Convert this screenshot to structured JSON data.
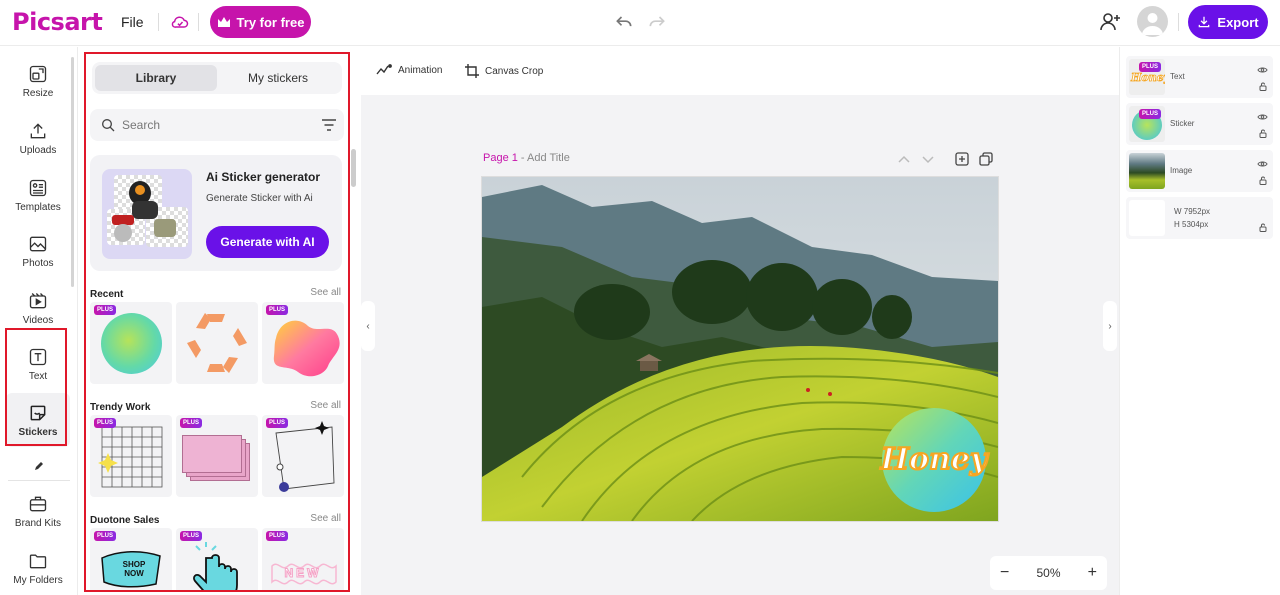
{
  "header": {
    "logo": "Picsart",
    "file_label": "File",
    "try_button": "Try for free",
    "export_button": "Export"
  },
  "nav": {
    "items": [
      {
        "label": "Resize",
        "icon": "resize-icon"
      },
      {
        "label": "Uploads",
        "icon": "upload-icon"
      },
      {
        "label": "Templates",
        "icon": "templates-icon"
      },
      {
        "label": "Photos",
        "icon": "photos-icon"
      },
      {
        "label": "Videos",
        "icon": "videos-icon"
      },
      {
        "label": "Text",
        "icon": "text-icon"
      },
      {
        "label": "Stickers",
        "icon": "stickers-icon"
      },
      {
        "label": "Brand Kits",
        "icon": "brand-kits-icon"
      },
      {
        "label": "My Folders",
        "icon": "folder-icon"
      }
    ],
    "active": "Stickers"
  },
  "panel": {
    "tabs": [
      "Library",
      "My stickers"
    ],
    "active_tab": "Library",
    "search_placeholder": "Search",
    "ai_card": {
      "title": "Ai Sticker generator",
      "subtitle": "Generate Sticker with Ai",
      "button": "Generate with AI"
    },
    "plus_badge": "PLUS",
    "sections": [
      {
        "title": "Recent",
        "see_all": "See all"
      },
      {
        "title": "Trendy Work",
        "see_all": "See all"
      },
      {
        "title": "Duotone Sales",
        "see_all": "See all"
      }
    ],
    "sticker_texts": {
      "shop_now": "SHOP NOW",
      "new": "NEW"
    }
  },
  "canvas": {
    "tools": [
      "Animation",
      "Canvas Crop"
    ],
    "page_label": "Page 1",
    "page_separator": " - ",
    "add_title": "Add Title",
    "sticker_text": "Honey",
    "zoom": "50%"
  },
  "layers": [
    {
      "name": "Text",
      "plus": true
    },
    {
      "name": "Sticker",
      "plus": true
    },
    {
      "name": "Image",
      "plus": false
    },
    {
      "name": "",
      "plus": false,
      "width": "W  7952px",
      "height": "H  5304px"
    }
  ],
  "colors": {
    "brand": "#c614ab",
    "accent": "#6a11e8",
    "highlight": "#e0182a"
  }
}
